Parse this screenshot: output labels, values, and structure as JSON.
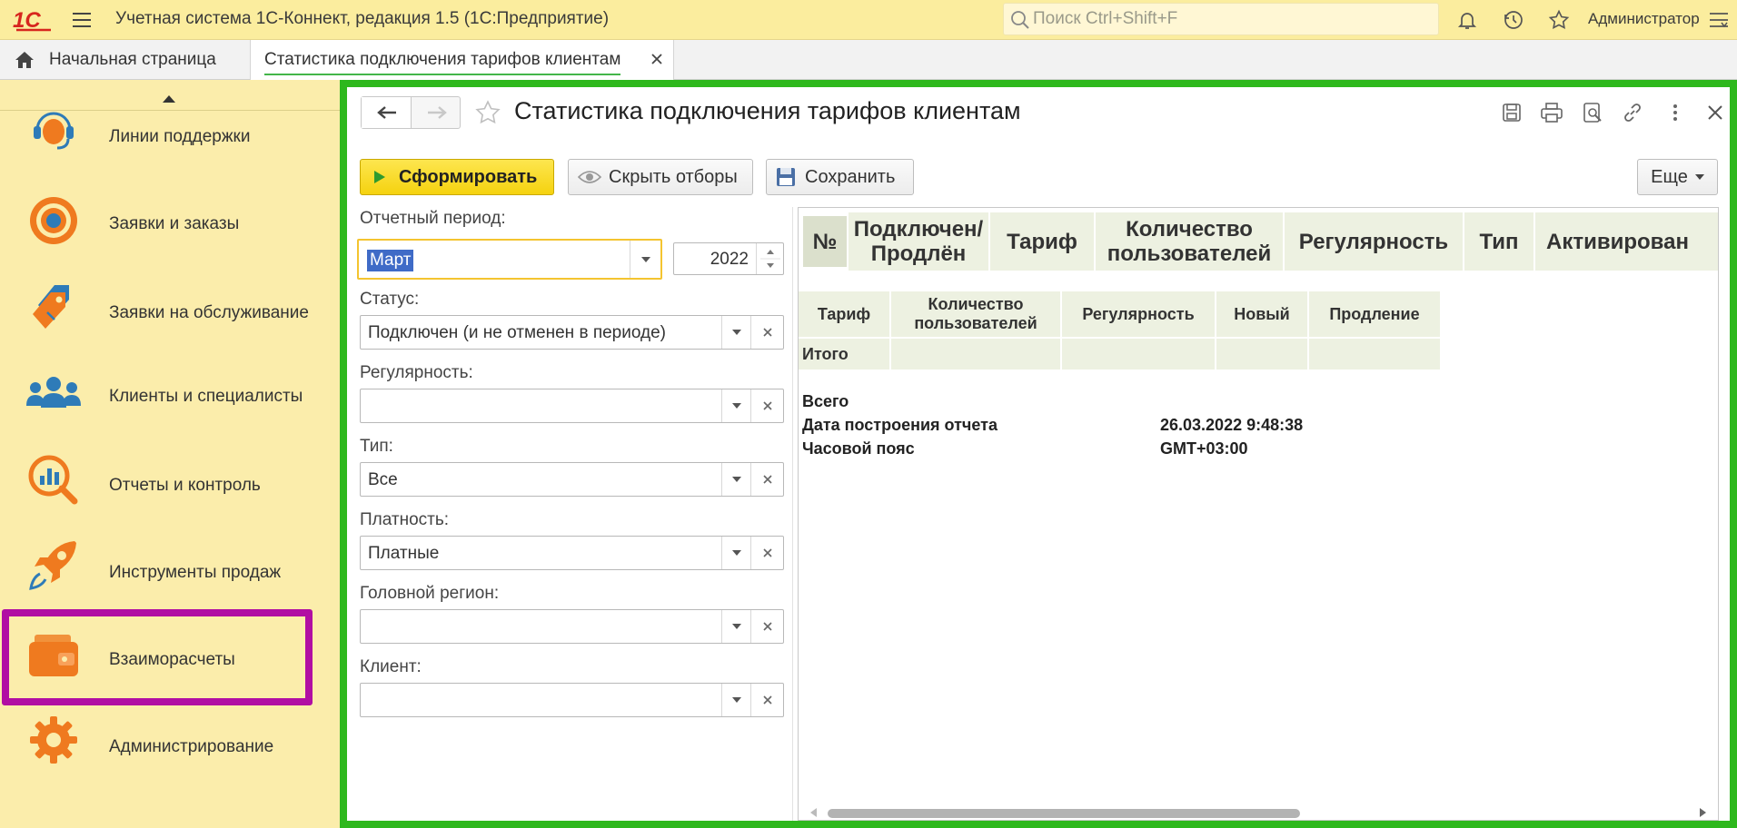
{
  "app": {
    "title": "Учетная система 1С-Коннект, редакция 1.5  (1С:Предприятие)",
    "logo_text": "1С",
    "search_placeholder": "Поиск Ctrl+Shift+F",
    "user": "Администратор"
  },
  "tabs": {
    "home": "Начальная страница",
    "report": "Статистика подключения тарифов клиентам"
  },
  "sidebar": {
    "items": [
      {
        "label": "Линии поддержки",
        "icon": "headset-icon"
      },
      {
        "label": "Заявки и заказы",
        "icon": "target-icon"
      },
      {
        "label": "Заявки на обслуживание",
        "icon": "tags-icon"
      },
      {
        "label": "Клиенты и специалисты",
        "icon": "people-icon"
      },
      {
        "label": "Отчеты и контроль",
        "icon": "magnifier-chart-icon"
      },
      {
        "label": "Инструменты продаж",
        "icon": "rocket-icon"
      },
      {
        "label": "Взаиморасчеты",
        "icon": "wallet-icon"
      },
      {
        "label": "Администрирование",
        "icon": "gear-icon"
      }
    ],
    "selected": "Взаиморасчеты"
  },
  "form": {
    "title": "Статистика подключения тарифов клиентам",
    "buttons": {
      "generate": "Сформировать",
      "hide_filters": "Скрыть отборы",
      "save": "Сохранить",
      "more": "Еще"
    }
  },
  "filters": {
    "period_label": "Отчетный период:",
    "period_month": "Март",
    "period_year": "2022",
    "status_label": "Статус:",
    "status_value": "Подключен (и не отменен в периоде)",
    "regularity_label": "Регулярность:",
    "regularity_value": "",
    "type_label": "Тип:",
    "type_value": "Все",
    "payment_label": "Платность:",
    "payment_value": "Платные",
    "region_label": "Головной регион:",
    "region_value": "",
    "client_label": "Клиент:",
    "client_value": ""
  },
  "report": {
    "main_header": [
      "№",
      "Подключен/ Продлён",
      "Тариф",
      "Количество пользователей",
      "Регулярность",
      "Тип",
      "Активирован"
    ],
    "summary_header": [
      "Тариф",
      "Количество пользователей",
      "Регулярность",
      "Новый",
      "Продление"
    ],
    "summary_total": "Итого",
    "total_label": "Всего",
    "date_label": "Дата построения отчета",
    "date_value": "26.03.2022 9:48:38",
    "tz_label": "Часовой пояс",
    "tz_value": "GMT+03:00"
  },
  "colors": {
    "topbar": "#fbed9e",
    "sidebar": "#fbedab",
    "accent_orange": "#ef7a1f",
    "frame_green": "#2eb81d",
    "highlight_magenta": "#b10ea3",
    "generate_yellow": "#f5d20f",
    "logo_red": "#d7261e"
  }
}
